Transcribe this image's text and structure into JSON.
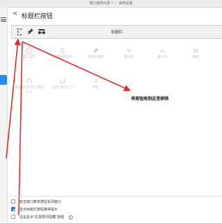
{
  "window": {
    "title": "窗口装饰元素 * — 系统设置"
  },
  "header": {
    "back": "<",
    "title": "标题栏按钮"
  },
  "preview": {
    "title": "标题栏",
    "buttons": [
      {
        "name": "more-icon",
        "label": ""
      },
      {
        "name": "pin-icon",
        "label": ""
      },
      {
        "name": "shade-glasses-icon",
        "label": ""
      }
    ]
  },
  "palette": {
    "items": [
      {
        "icon": "app-menu-icon",
        "label": "窗口菜单"
      },
      {
        "icon": "app-menu-list-icon",
        "label": "应用程序菜单"
      },
      {
        "icon": "pin-icon",
        "label": "在所有桌面"
      },
      {
        "icon": "minimize-icon",
        "label": "最小化"
      },
      {
        "icon": "maximize-icon",
        "label": "最大化"
      },
      {
        "icon": "close-icon",
        "label": "关闭"
      },
      {
        "icon": "keep-above-icon",
        "label": "保持窗口在其它窗口之上"
      },
      {
        "icon": "keep-below-icon",
        "label": "在其它窗口之下"
      },
      {
        "icon": "shade-icon",
        "label": "卷起"
      }
    ]
  },
  "annotation": {
    "text": "将按钮拖到这里移除",
    "color": "#e02b2b"
  },
  "options": [
    {
      "label": "双击窗口菜单按钮关闭窗口",
      "checked": false
    },
    {
      "label": "显示标题栏按钮悬停提示",
      "checked": true
    },
    {
      "label": "总是显示\"在录屏中隐藏\"按钮",
      "checked": false,
      "has_info": true
    }
  ],
  "colors": {
    "accent": "#2a8be6",
    "arrow": "#e02b2b"
  }
}
